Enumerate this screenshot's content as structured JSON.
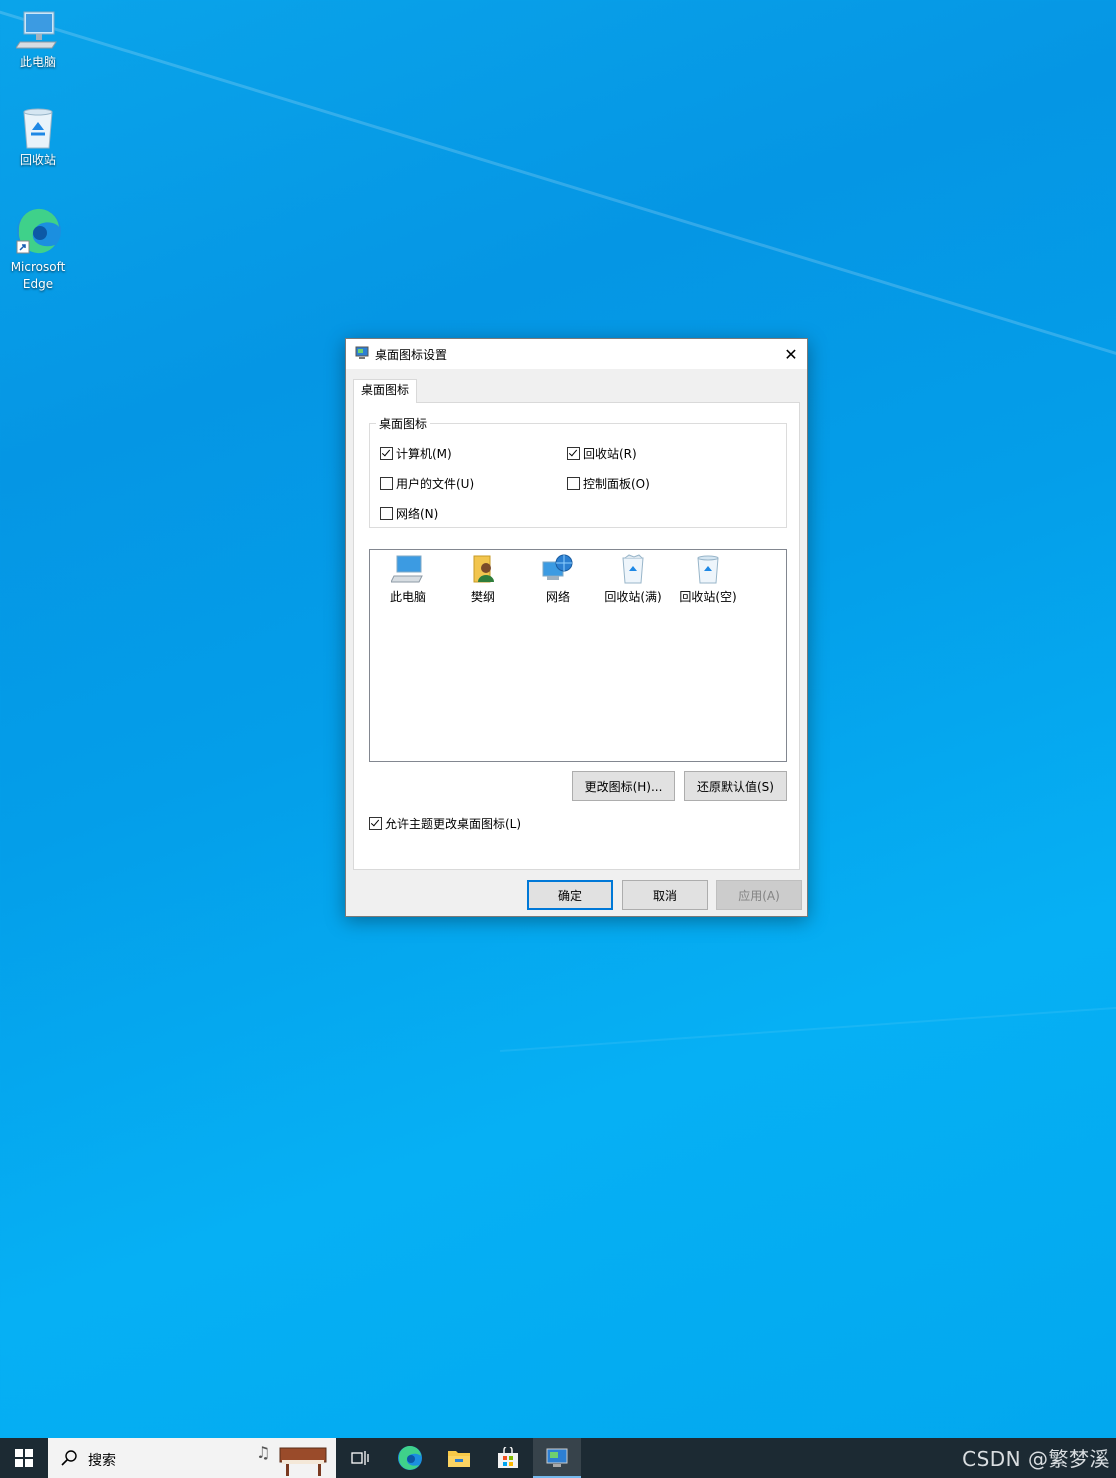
{
  "desktop": {
    "icons": [
      {
        "label": "此电脑",
        "icon": "this-pc-icon"
      },
      {
        "label": "回收站",
        "icon": "recycle-bin-icon"
      },
      {
        "label": "Microsoft Edge",
        "icon": "edge-icon"
      }
    ]
  },
  "dialog": {
    "title": "桌面图标设置",
    "close_glyph": "✕",
    "tab_label": "桌面图标",
    "group_label": "桌面图标",
    "checkboxes": [
      {
        "label": "计算机(M)",
        "checked": true
      },
      {
        "label": "回收站(R)",
        "checked": true
      },
      {
        "label": "用户的文件(U)",
        "checked": false
      },
      {
        "label": "控制面板(O)",
        "checked": false
      },
      {
        "label": "网络(N)",
        "checked": false
      }
    ],
    "icon_list": [
      {
        "label": "此电脑",
        "icon": "computer-icon"
      },
      {
        "label": "樊纲",
        "icon": "user-folder-icon"
      },
      {
        "label": "网络",
        "icon": "network-icon"
      },
      {
        "label": "回收站(满)",
        "icon": "recycle-full-icon"
      },
      {
        "label": "回收站(空)",
        "icon": "recycle-empty-icon"
      }
    ],
    "change_icon_button": "更改图标(H)...",
    "restore_default_button": "还原默认值(S)",
    "allow_themes": {
      "label": "允许主题更改桌面图标(L)",
      "checked": true
    },
    "ok_button": "确定",
    "cancel_button": "取消",
    "apply_button": "应用(A)"
  },
  "taskbar": {
    "search_placeholder": "搜索",
    "items": [
      "start-icon",
      "search-icon",
      "task-view-icon",
      "edge-icon",
      "file-explorer-icon",
      "store-icon",
      "desktop-icon-settings-icon"
    ],
    "watermark": "CSDN @繁梦溪"
  },
  "colors": {
    "desktop_blue": "#049ee9",
    "taskbar": "#1c2a33",
    "accent": "#0078d7"
  }
}
